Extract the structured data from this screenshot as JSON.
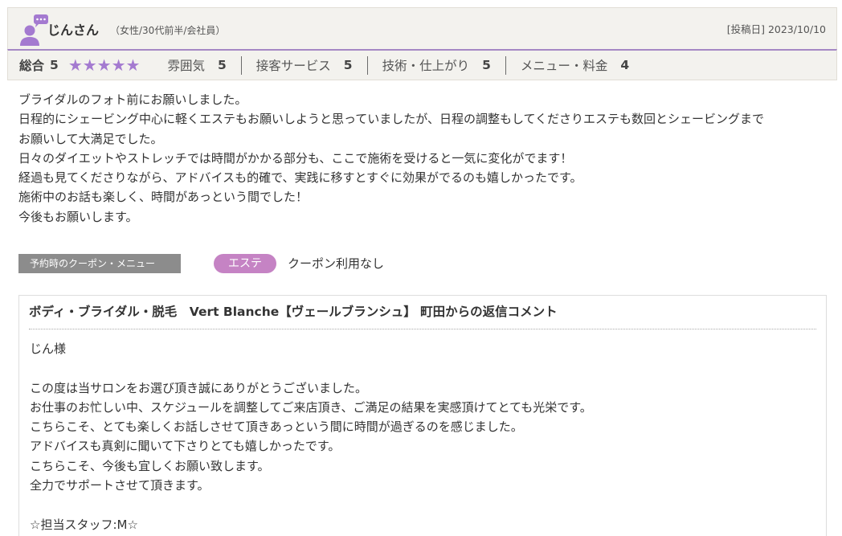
{
  "review": {
    "reviewer": {
      "name": "じんさん",
      "meta": "（女性/30代前半/会社員）",
      "avatar_icon": "user-comment-icon"
    },
    "posted_label": "[投稿日]",
    "posted_date": "2023/10/10",
    "ratings": {
      "overall_label": "総合",
      "overall_score": "5",
      "stars": "★★★★★",
      "star_color": "#a47ad0",
      "categories": [
        {
          "label": "雰囲気",
          "score": "5"
        },
        {
          "label": "接客サービス",
          "score": "5"
        },
        {
          "label": "技術・仕上がり",
          "score": "5"
        },
        {
          "label": "メニュー・料金",
          "score": "4"
        }
      ]
    },
    "body": [
      "ブライダルのフォト前にお願いしました。",
      "日程的にシェービング中心に軽くエステもお願いしようと思っていましたが、日程の調整もしてくださりエステも数回とシェービングまで",
      "お願いして大満足でした。",
      "日々のダイエットやストレッチでは時間がかかる部分も、ここで施術を受けると一気に変化がでます！",
      "経過も見てくださりながら、アドバイスも的確で、実践に移すとすぐに効果がでるのも嬉しかったです。",
      "施術中のお話も楽しく、時間があっという間でした！",
      "今後もお願いします。"
    ],
    "coupon": {
      "label": "予約時のクーポン・メニュー",
      "genre": "エステ",
      "genre_color": "#c583c4",
      "text": "クーポン利用なし"
    }
  },
  "reply": {
    "title": "ボディ・ブライダル・脱毛　Vert Blanche【ヴェールブランシュ】 町田からの返信コメント",
    "body": [
      "じん様",
      "",
      "この度は当サロンをお選び頂き誠にありがとうございました。",
      "お仕事のお忙しい中、スケジュールを調整してご来店頂き、ご満足の結果を実感頂けてとても光栄です。",
      "こちらこそ、とても楽しくお話しさせて頂きあっという間に時間が過ぎるのを感じました。",
      "アドバイスも真剣に聞いて下さりとても嬉しかったです。",
      "こちらこそ、今後も宜しくお願い致します。",
      "全力でサポートさせて頂きます。",
      "",
      "☆担当スタッフ:M☆"
    ]
  }
}
